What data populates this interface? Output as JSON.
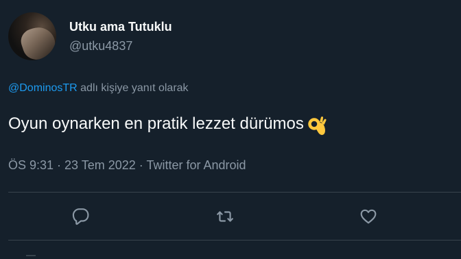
{
  "tweet": {
    "author": {
      "display_name": "Utku ama Tutuklu",
      "handle": "@utku4837"
    },
    "reply_to": {
      "mention": "@DominosTR",
      "suffix": " adlı kişiye yanıt olarak"
    },
    "text": "Oyun oynarken en pratik lezzet dürümos",
    "emoji": "ok-hand-emoji",
    "meta": "ÖS 9:31 · 23 Tem 2022 · Twitter for Android"
  },
  "actions": {
    "reply_icon": "reply-icon",
    "retweet_icon": "retweet-icon",
    "like_icon": "heart-icon"
  },
  "colors": {
    "background": "#15202b",
    "primary_text": "#f7f9f9",
    "secondary_text": "#8b98a5",
    "accent": "#1d9bf0",
    "divider": "#38444d"
  }
}
